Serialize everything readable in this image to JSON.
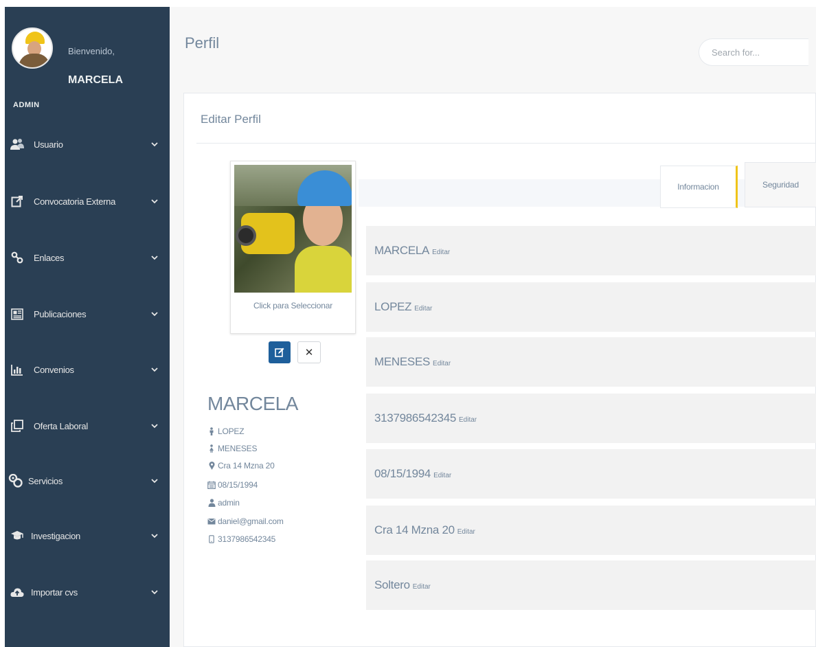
{
  "sidebar": {
    "welcome": "Bienvenido,",
    "user_name": "MARCELA",
    "role": "ADMIN",
    "items": [
      {
        "label": "Usuario",
        "icon": "users-icon"
      },
      {
        "label": "Convocatoria Externa",
        "icon": "external-link-icon"
      },
      {
        "label": "Enlaces",
        "icon": "link-icon"
      },
      {
        "label": "Publicaciones",
        "icon": "newspaper-icon"
      },
      {
        "label": "Convenios",
        "icon": "bar-chart-icon"
      },
      {
        "label": "Oferta Laboral",
        "icon": "clone-icon"
      },
      {
        "label": "Servicios",
        "icon": "handshake-icon"
      },
      {
        "label": "Investigacion",
        "icon": "graduation-cap-icon"
      },
      {
        "label": "Importar cvs",
        "icon": "cloud-upload-icon"
      }
    ]
  },
  "header": {
    "title": "Perfil",
    "search_placeholder": "Search for..."
  },
  "panel": {
    "title": "Editar Perfil",
    "photo_caption": "Click para Seleccionar",
    "name": "MARCELA",
    "details": [
      {
        "icon": "male-icon",
        "text": "LOPEZ"
      },
      {
        "icon": "female-icon",
        "text": "MENESES"
      },
      {
        "icon": "map-marker-icon",
        "text": "Cra 14 Mzna 20"
      },
      {
        "icon": "calendar-icon",
        "text": "08/15/1994"
      },
      {
        "icon": "user-icon",
        "text": "admin"
      },
      {
        "icon": "envelope-icon",
        "text": "daniel@gmail.com"
      },
      {
        "icon": "mobile-icon",
        "text": "3137986542345"
      }
    ],
    "tabs": [
      {
        "label": "Informacion",
        "active": true
      },
      {
        "label": "Seguridad",
        "active": false
      }
    ],
    "fields": [
      {
        "value": "MARCELA",
        "edit": "Editar"
      },
      {
        "value": "LOPEZ",
        "edit": "Editar"
      },
      {
        "value": "MENESES",
        "edit": "Editar"
      },
      {
        "value": "3137986542345",
        "edit": "Editar"
      },
      {
        "value": "08/15/1994",
        "edit": "Editar"
      },
      {
        "value": "Cra 14 Mzna 20",
        "edit": "Editar"
      },
      {
        "value": "Soltero",
        "edit": "Editar"
      }
    ]
  },
  "colors": {
    "sidebar": "#2a3f54",
    "accent_tab": "#f0c419",
    "edit_button": "#1e5f9b",
    "text_muted": "#73879c"
  }
}
